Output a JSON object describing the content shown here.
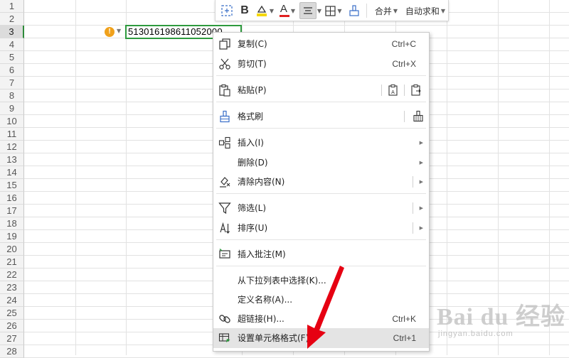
{
  "sheet": {
    "row_numbers": [
      "1",
      "2",
      "3",
      "4",
      "5",
      "6",
      "7",
      "8",
      "9",
      "10",
      "11",
      "12",
      "13",
      "14",
      "15",
      "16",
      "17",
      "18",
      "19",
      "20",
      "21",
      "22",
      "23",
      "24",
      "25",
      "26",
      "27",
      "28"
    ],
    "selected_row": "3",
    "active_cell_value": "513016198611052000",
    "warning_glyph": "!"
  },
  "toolbar": {
    "merge_label": "合并",
    "autosum_label": "自动求和",
    "bold_label": "B",
    "font_color_label": "A",
    "font_color": "#e02020",
    "highlight_color": "#f5d800"
  },
  "context_menu": {
    "items": [
      {
        "label": "复制(C)",
        "shortcut": "Ctrl+C",
        "icon": "copy-icon"
      },
      {
        "label": "剪切(T)",
        "shortcut": "Ctrl+X",
        "icon": "scissors-icon"
      },
      {
        "label": "粘贴(P)",
        "shortcut": "",
        "icon": "paste-icon"
      },
      {
        "label": "格式刷",
        "shortcut": "",
        "icon": "format-painter-icon"
      },
      {
        "label": "插入(I)",
        "shortcut": "",
        "icon": "insert-icon"
      },
      {
        "label": "删除(D)",
        "shortcut": "",
        "icon": ""
      },
      {
        "label": "清除内容(N)",
        "shortcut": "",
        "icon": "clear-icon"
      },
      {
        "label": "筛选(L)",
        "shortcut": "",
        "icon": "filter-icon"
      },
      {
        "label": "排序(U)",
        "shortcut": "",
        "icon": "sort-icon"
      },
      {
        "label": "插入批注(M)",
        "shortcut": "",
        "icon": "comment-icon"
      },
      {
        "label": "从下拉列表中选择(K)...",
        "shortcut": "",
        "icon": ""
      },
      {
        "label": "定义名称(A)...",
        "shortcut": "",
        "icon": ""
      },
      {
        "label": "超链接(H)...",
        "shortcut": "Ctrl+K",
        "icon": "link-icon"
      },
      {
        "label": "设置单元格格式(F)...",
        "shortcut": "Ctrl+1",
        "icon": "format-cells-icon",
        "highlighted": true
      }
    ]
  },
  "watermark": {
    "brand": "Bai du 经验",
    "url": "jingyan.baidu.com"
  },
  "colors": {
    "accent_green": "#2e9a3e",
    "arrow_red": "#e60012",
    "warning_orange": "#f0a11b",
    "icon_blue": "#3a6fc8"
  }
}
